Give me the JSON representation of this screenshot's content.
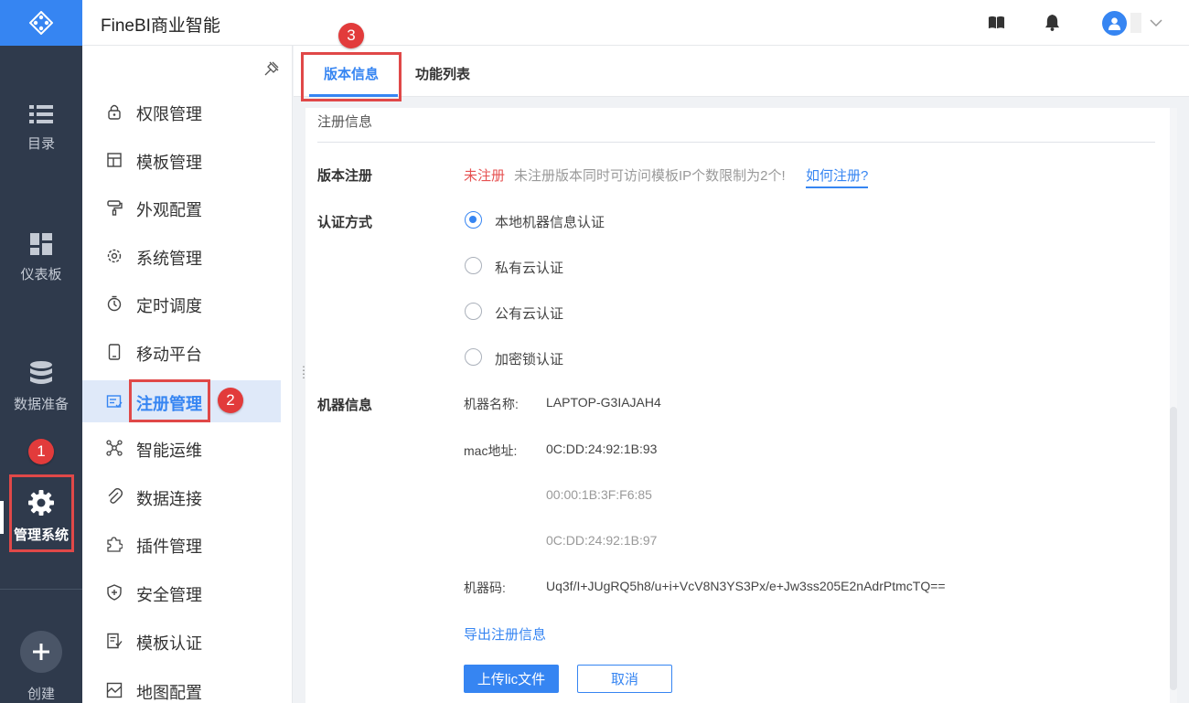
{
  "rail": {
    "items": [
      {
        "label": "目录",
        "icon": "list-icon"
      },
      {
        "label": "仪表板",
        "icon": "dashboard-icon"
      },
      {
        "label": "数据准备",
        "icon": "database-icon"
      },
      {
        "label": "管理系统",
        "icon": "gear-icon",
        "active": true
      }
    ],
    "create_label": "创建"
  },
  "header": {
    "title": "FineBI商业智能",
    "icons": [
      "book-icon",
      "bell-icon",
      "avatar-icon",
      "chevron-down-icon"
    ]
  },
  "menu": {
    "items": [
      {
        "label": "权限管理",
        "icon": "lock-icon"
      },
      {
        "label": "模板管理",
        "icon": "template-icon"
      },
      {
        "label": "外观配置",
        "icon": "paint-roller-icon"
      },
      {
        "label": "系统管理",
        "icon": "settings-icon"
      },
      {
        "label": "定时调度",
        "icon": "stopwatch-icon"
      },
      {
        "label": "移动平台",
        "icon": "mobile-icon"
      },
      {
        "label": "注册管理",
        "icon": "register-icon",
        "active": true
      },
      {
        "label": "智能运维",
        "icon": "network-icon"
      },
      {
        "label": "数据连接",
        "icon": "paperclip-icon"
      },
      {
        "label": "插件管理",
        "icon": "puzzle-icon"
      },
      {
        "label": "安全管理",
        "icon": "shield-icon"
      },
      {
        "label": "模板认证",
        "icon": "certificate-icon"
      },
      {
        "label": "地图配置",
        "icon": "map-icon"
      }
    ]
  },
  "tabs": [
    {
      "label": "版本信息",
      "active": true
    },
    {
      "label": "功能列表"
    }
  ],
  "panel": {
    "section_title": "注册信息",
    "version_register": {
      "label": "版本注册",
      "status": "未注册",
      "note": "未注册版本同时可访问模板IP个数限制为2个!",
      "help_link": "如何注册?"
    },
    "auth": {
      "label": "认证方式",
      "options": [
        {
          "label": "本地机器信息认证",
          "checked": true
        },
        {
          "label": "私有云认证",
          "checked": false
        },
        {
          "label": "公有云认证",
          "checked": false
        },
        {
          "label": "加密锁认证",
          "checked": false
        }
      ]
    },
    "machine": {
      "label": "机器信息",
      "name_label": "机器名称:",
      "name_value": "LAPTOP-G3IAJAH4",
      "mac_label": "mac地址:",
      "mac_values": [
        "0C:DD:24:92:1B:93",
        "00:00:1B:3F:F6:85",
        "0C:DD:24:92:1B:97"
      ],
      "code_label": "机器码:",
      "code_value": "Uq3f/I+JUgRQ5h8/u+i+VcV8N3YS3Px/e+Jw3ss205E2nAdrPtmcTQ=="
    },
    "export_link": "导出注册信息",
    "upload_button": "上传lic文件",
    "cancel_button": "取消"
  },
  "annotations": {
    "badges": [
      "1",
      "2",
      "3"
    ]
  },
  "colors": {
    "accent": "#3685f2",
    "rail_bg": "#2f3a4c",
    "highlight_red": "#e04848",
    "status_red": "#e65151"
  }
}
